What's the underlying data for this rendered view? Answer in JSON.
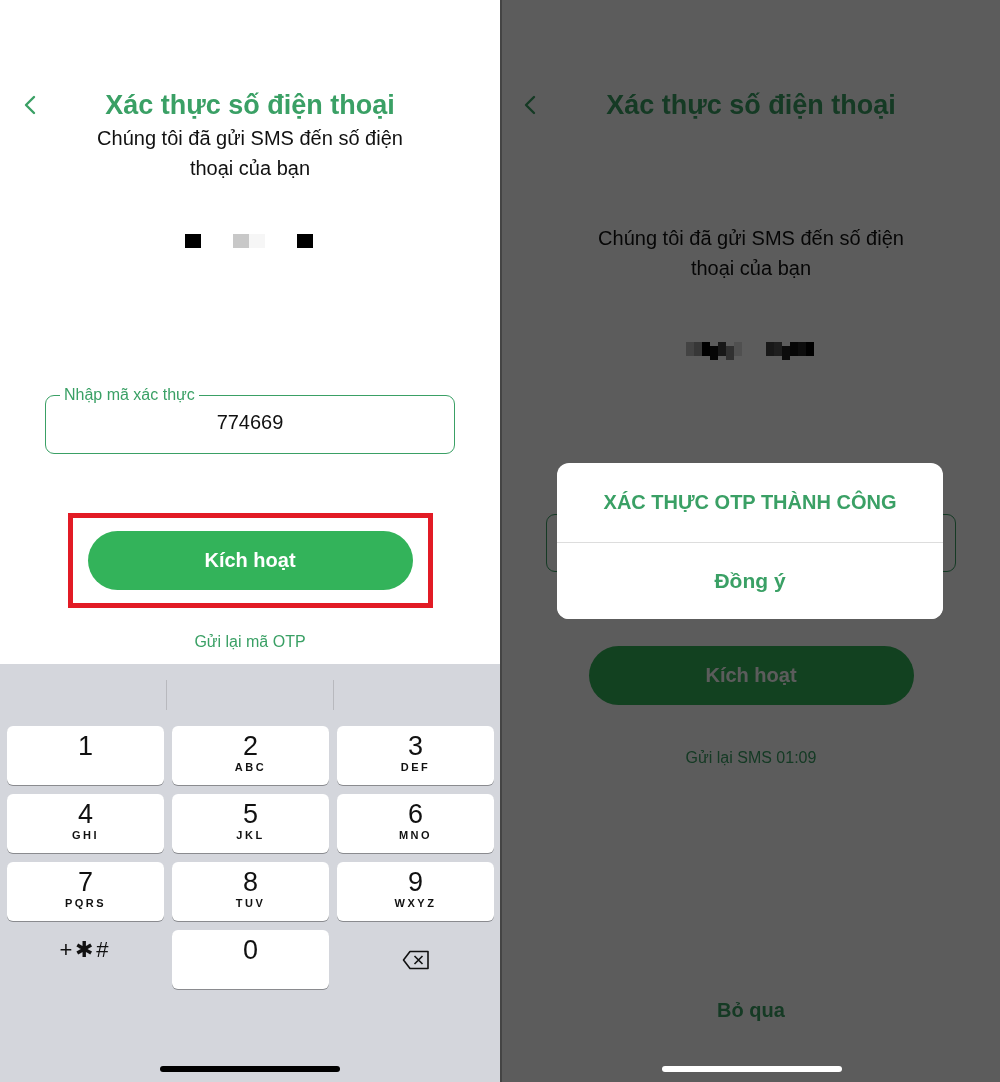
{
  "entry_screen": {
    "title": "Xác thực số điện thoại",
    "message": "Chúng tôi đã gửi SMS đến số điện thoại của bạn",
    "code_field": {
      "label": "Nhập mã xác thực",
      "value": "774669"
    },
    "activate_button": {
      "label": "Kích hoạt",
      "highlighted": true
    },
    "resend_link": "Gửi lại mã OTP",
    "keypad": [
      {
        "kind": "digit",
        "digit": "1"
      },
      {
        "kind": "digit",
        "digit": "2",
        "letters": "ABC"
      },
      {
        "kind": "digit",
        "digit": "3",
        "letters": "DEF"
      },
      {
        "kind": "digit",
        "digit": "4",
        "letters": "GHI"
      },
      {
        "kind": "digit",
        "digit": "5",
        "letters": "JKL"
      },
      {
        "kind": "digit",
        "digit": "6",
        "letters": "MNO"
      },
      {
        "kind": "digit",
        "digit": "7",
        "letters": "PQRS"
      },
      {
        "kind": "digit",
        "digit": "8",
        "letters": "TUV"
      },
      {
        "kind": "digit",
        "digit": "9",
        "letters": "WXYZ"
      },
      {
        "kind": "symbols",
        "digit": "+✱#"
      },
      {
        "kind": "digit",
        "digit": "0"
      },
      {
        "kind": "delete"
      }
    ]
  },
  "success_screen": {
    "title": "Xác thực số điện thoại",
    "message": "Chúng tôi đã gửi SMS đến số điện thoại của bạn",
    "activate_button": {
      "label": "Kích hoạt",
      "highlighted": false
    },
    "resend_timer": "Gửi lại SMS 01:09",
    "skip_link": "Bỏ qua",
    "dialog": {
      "title": "XÁC THỰC OTP THÀNH CÔNG",
      "confirm": "Đồng ý"
    }
  }
}
